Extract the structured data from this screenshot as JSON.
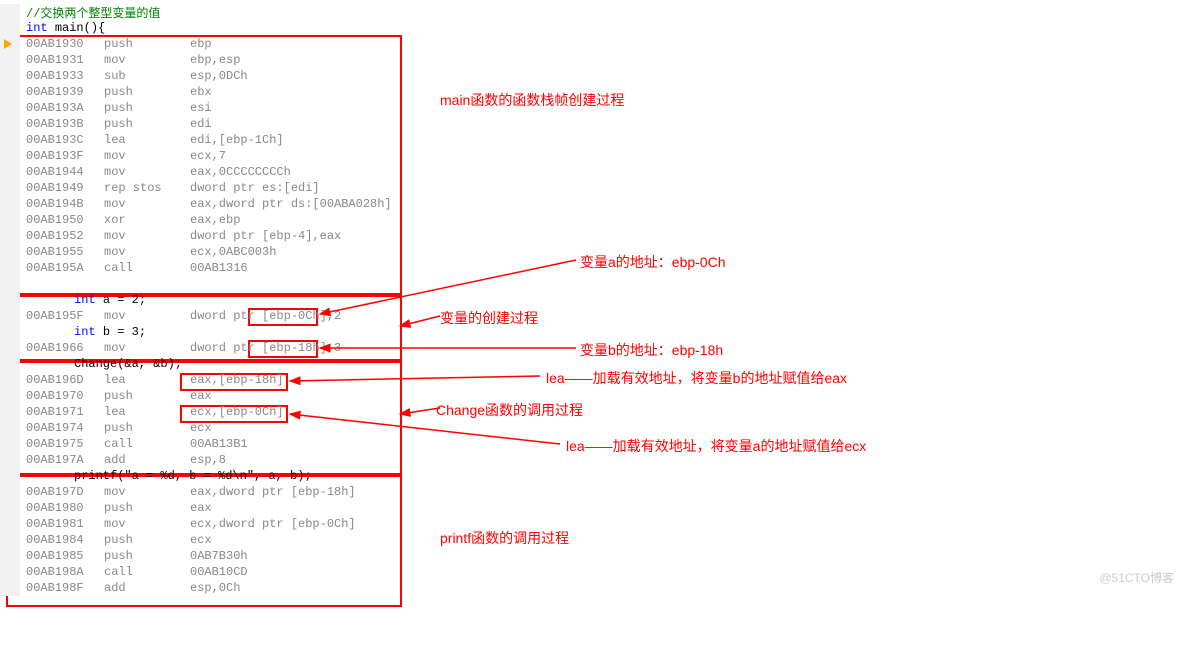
{
  "src": {
    "comment": "//交换两个整型变量的值",
    "int": "int",
    "main_sig": "main(){",
    "decl_a": "a = 2;",
    "decl_b": "b = 3;",
    "change_call": "Change(&a, &b);",
    "printf_call": "printf(\"a = %d, b = %d\\n\", a, b);"
  },
  "asm": {
    "s1": [
      {
        "a": "00AB1930",
        "o": "push",
        "r": "ebp"
      },
      {
        "a": "00AB1931",
        "o": "mov",
        "r": "ebp,esp"
      },
      {
        "a": "00AB1933",
        "o": "sub",
        "r": "esp,0DCh"
      },
      {
        "a": "00AB1939",
        "o": "push",
        "r": "ebx"
      },
      {
        "a": "00AB193A",
        "o": "push",
        "r": "esi"
      },
      {
        "a": "00AB193B",
        "o": "push",
        "r": "edi"
      },
      {
        "a": "00AB193C",
        "o": "lea",
        "r": "edi,[ebp-1Ch]"
      },
      {
        "a": "00AB193F",
        "o": "mov",
        "r": "ecx,7"
      },
      {
        "a": "00AB1944",
        "o": "mov",
        "r": "eax,0CCCCCCCCh"
      },
      {
        "a": "00AB1949",
        "o": "rep stos",
        "r": "dword ptr es:[edi]"
      },
      {
        "a": "00AB194B",
        "o": "mov",
        "r": "eax,dword ptr ds:[00ABA028h]"
      },
      {
        "a": "00AB1950",
        "o": "xor",
        "r": "eax,ebp"
      },
      {
        "a": "00AB1952",
        "o": "mov",
        "r": "dword ptr [ebp-4],eax"
      },
      {
        "a": "00AB1955",
        "o": "mov",
        "r": "ecx,0ABC003h"
      },
      {
        "a": "00AB195A",
        "o": "call",
        "r": "00AB1316"
      },
      {
        "a": "",
        "o": "",
        "r": ""
      }
    ],
    "s2": [
      {
        "a": "00AB195F",
        "o": "mov",
        "r": "dword ptr [ebp-0Ch],2"
      },
      {
        "a": "00AB1966",
        "o": "mov",
        "r": "dword ptr [ebp-18h],3"
      }
    ],
    "s3": [
      {
        "a": "00AB196D",
        "o": "lea",
        "r": "eax,[ebp-18h]"
      },
      {
        "a": "00AB1970",
        "o": "push",
        "r": "eax"
      },
      {
        "a": "00AB1971",
        "o": "lea",
        "r": "ecx,[ebp-0Ch]"
      },
      {
        "a": "00AB1974",
        "o": "push",
        "r": "ecx"
      },
      {
        "a": "00AB1975",
        "o": "call",
        "r": "00AB13B1"
      },
      {
        "a": "00AB197A",
        "o": "add",
        "r": "esp,8"
      }
    ],
    "s4": [
      {
        "a": "00AB197D",
        "o": "mov",
        "r": "eax,dword ptr [ebp-18h]"
      },
      {
        "a": "00AB1980",
        "o": "push",
        "r": "eax"
      },
      {
        "a": "00AB1981",
        "o": "mov",
        "r": "ecx,dword ptr [ebp-0Ch]"
      },
      {
        "a": "00AB1984",
        "o": "push",
        "r": "ecx"
      },
      {
        "a": "00AB1985",
        "o": "push",
        "r": "0AB7B30h"
      },
      {
        "a": "00AB198A",
        "o": "call",
        "r": "00AB10CD"
      },
      {
        "a": "00AB198F",
        "o": "add",
        "r": "esp,0Ch"
      }
    ]
  },
  "labels": {
    "main_frame": "main函数的函数栈帧创建过程",
    "var_a_addr": "变量a的地址：ebp-0Ch",
    "var_create": "变量的创建过程",
    "var_b_addr": "变量b的地址：ebp-18h",
    "lea_b": "lea——加载有效地址，将变量b的地址赋值给eax",
    "change_call": "Change函数的调用过程",
    "lea_a": "lea——加载有效地址，将变量a的地址赋值给ecx",
    "printf_call": "printf函数的调用过程"
  },
  "watermark": "@51CTO博客"
}
